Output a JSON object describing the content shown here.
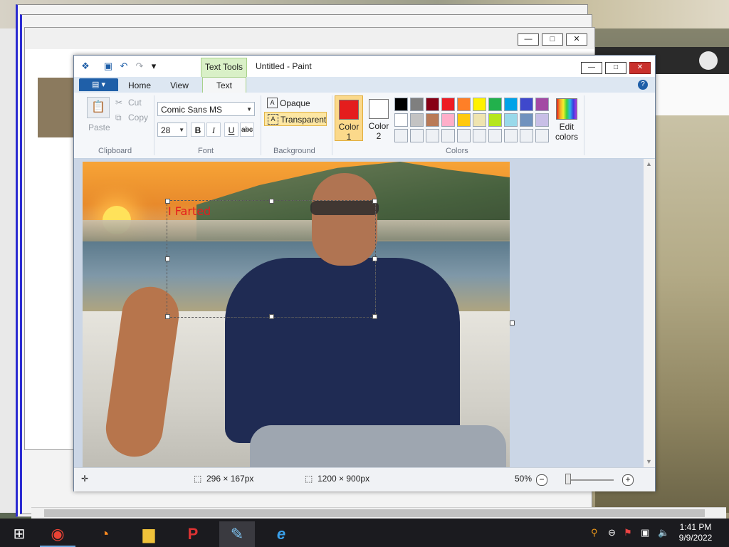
{
  "paint": {
    "title": "Untitled - Paint",
    "context_tab": "Text Tools",
    "file_tab_icon": "file-menu-icon",
    "tabs": [
      "Home",
      "View",
      "Text"
    ],
    "help": "?",
    "clipboard": {
      "paste": "Paste",
      "cut": "Cut",
      "copy": "Copy",
      "label": "Clipboard"
    },
    "font": {
      "family": "Comic Sans MS",
      "size": "28",
      "bold": "B",
      "italic": "I",
      "underline": "U",
      "strike": "abc",
      "label": "Font"
    },
    "background": {
      "opaque": "Opaque",
      "transparent": "Transparent",
      "label": "Background"
    },
    "colors": {
      "color1_label": "Color",
      "color1_num": "1",
      "color2_label": "Color",
      "color2_num": "2",
      "edit": "Edit",
      "edit2": "colors",
      "label": "Colors",
      "color1_value": "#e41d1d",
      "color2_value": "#ffffff",
      "palette_row1": [
        "#000000",
        "#7f7f7f",
        "#880015",
        "#ed1c24",
        "#ff7f27",
        "#fff200",
        "#22b14c",
        "#00a2e8",
        "#3f48cc",
        "#a349a4"
      ],
      "palette_row2": [
        "#ffffff",
        "#c3c3c3",
        "#b97a57",
        "#ffaec9",
        "#ffc90e",
        "#efe4b0",
        "#b5e61d",
        "#99d9ea",
        "#7092be",
        "#c8bfe7"
      ]
    },
    "typed_text": "I Farted",
    "status": {
      "selection": "296 × 167px",
      "image_size": "1200 × 900px",
      "zoom": "50%",
      "zoom_level": 0.5
    },
    "window_controls": {
      "minimize": "—",
      "maximize": "□",
      "close": "✕"
    }
  },
  "background_windows": {
    "back_browser_controls": {
      "minimize": "—",
      "maximize": "□",
      "close": "✕"
    }
  },
  "taskbar": {
    "apps": [
      {
        "name": "chrome",
        "glyph": "◉"
      },
      {
        "name": "firefox",
        "glyph": "◔"
      },
      {
        "name": "file-explorer",
        "glyph": "▆"
      },
      {
        "name": "app-p",
        "glyph": "P"
      },
      {
        "name": "paint",
        "glyph": "✎"
      },
      {
        "name": "internet-explorer",
        "glyph": "e"
      }
    ],
    "time": "1:41 PM",
    "date": "9/9/2022"
  }
}
